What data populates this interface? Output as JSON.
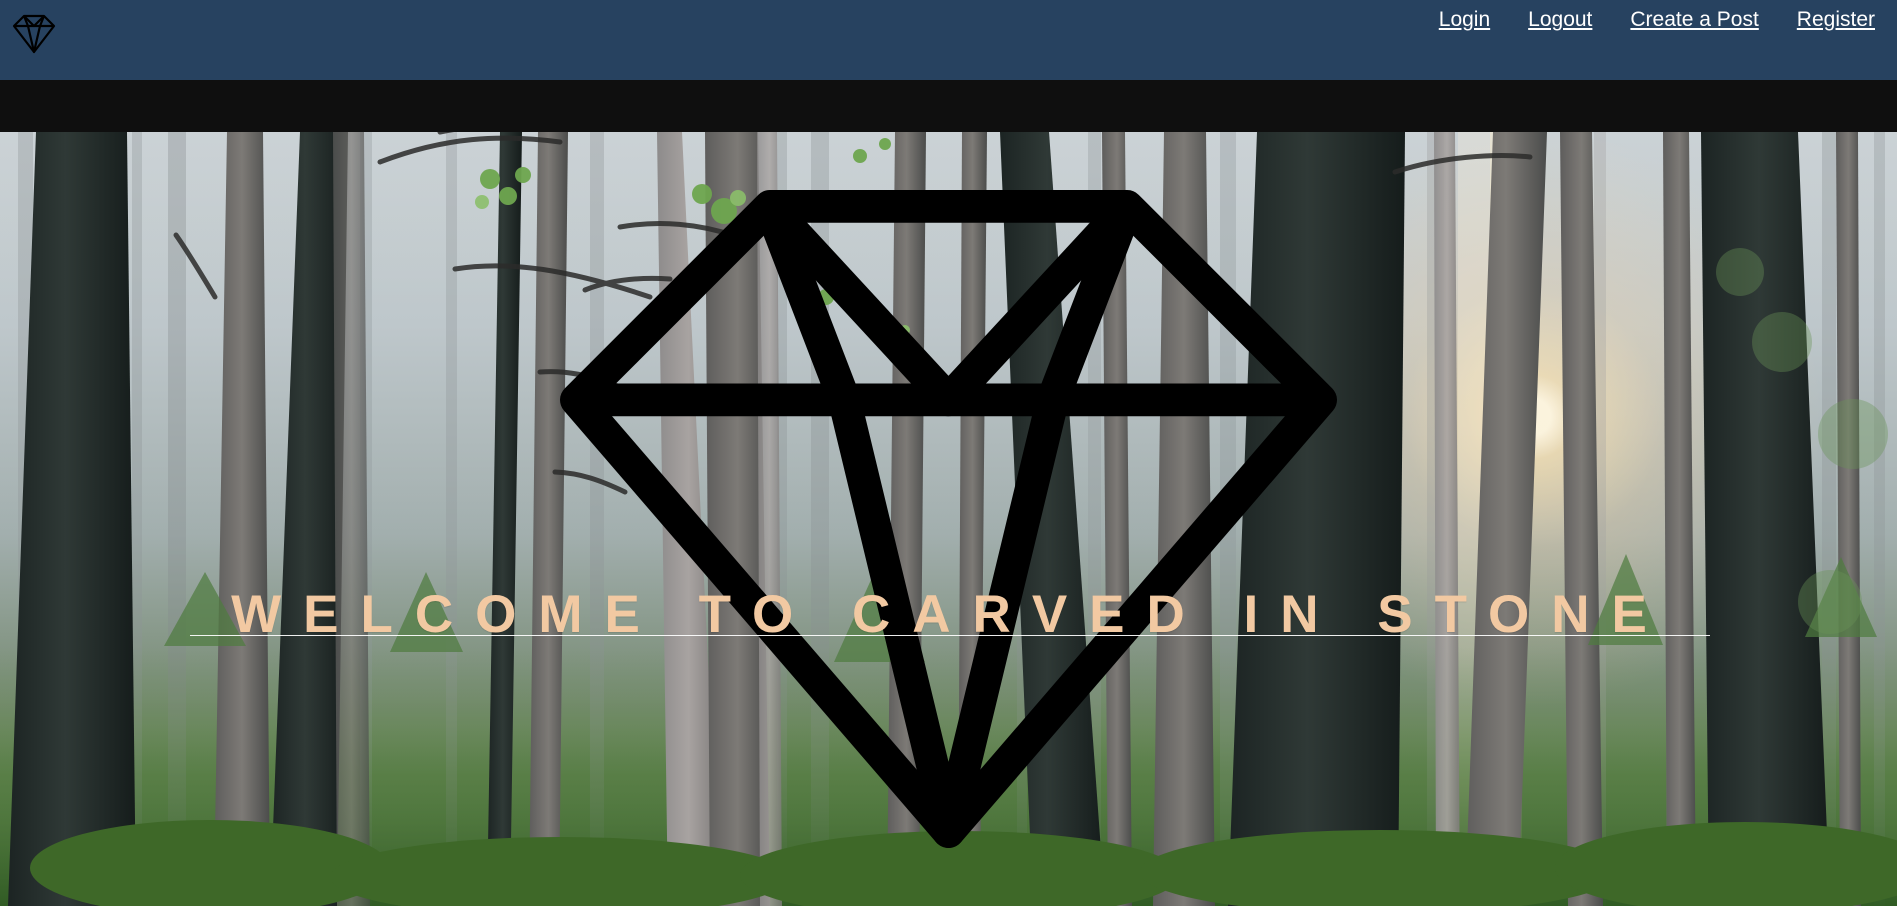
{
  "header": {
    "logo_icon": "diamond-icon",
    "nav_items": [
      {
        "label": "Login"
      },
      {
        "label": "Logout"
      },
      {
        "label": "Create a Post"
      },
      {
        "label": "Register"
      }
    ]
  },
  "hero": {
    "title": "WELCOME TO CARVED IN STONE",
    "accent_icon": "diamond-icon",
    "colors": {
      "header_bg": "#274260",
      "strip_bg": "#0f0f0f",
      "title_text": "#f2c9a2",
      "rule": "#ffffff"
    }
  }
}
